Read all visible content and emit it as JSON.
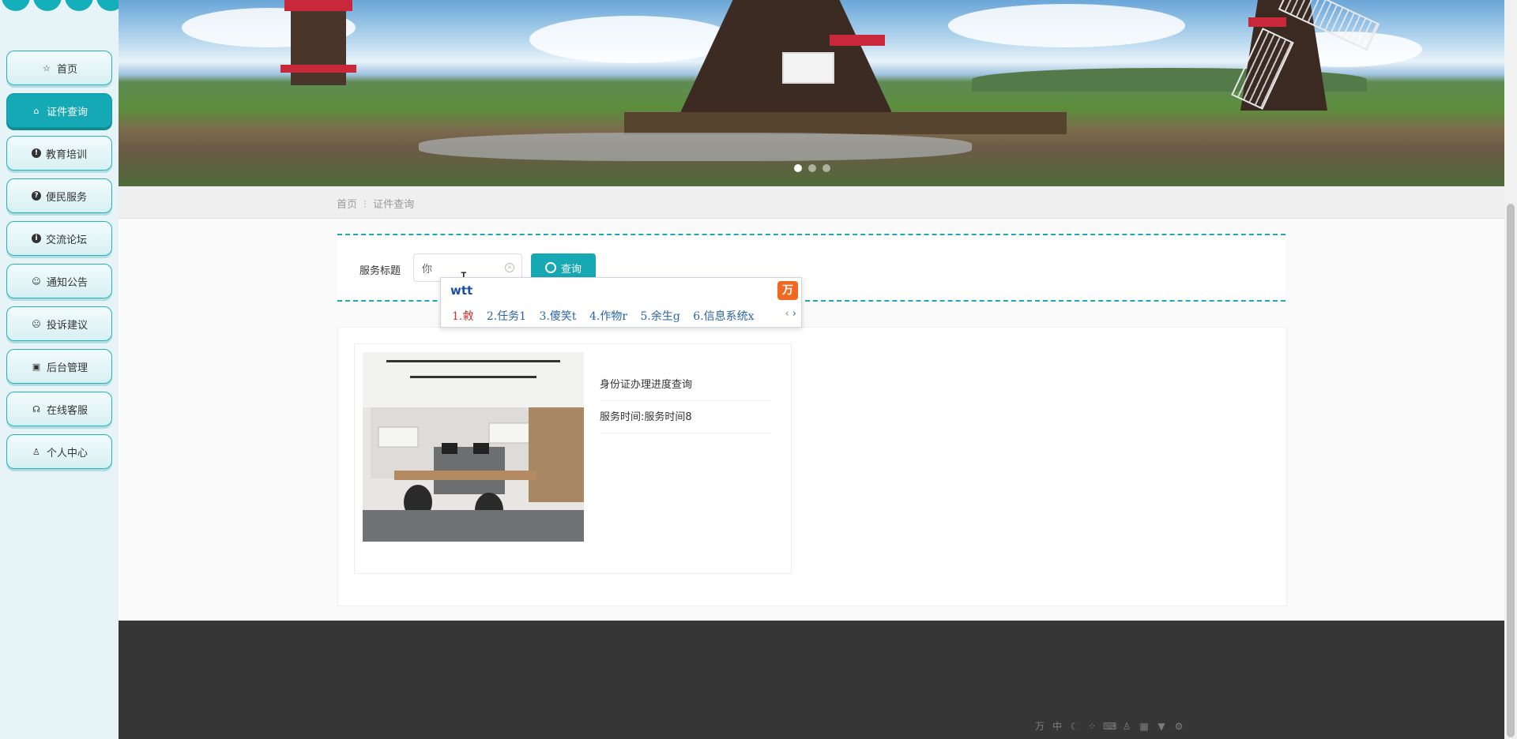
{
  "sidebar": {
    "items": [
      {
        "label": "首页",
        "icon": "star-icon"
      },
      {
        "label": "证件查询",
        "icon": "bag-icon",
        "active": true
      },
      {
        "label": "教育培训",
        "icon": "exclamation-icon"
      },
      {
        "label": "便民服务",
        "icon": "question-icon"
      },
      {
        "label": "交流论坛",
        "icon": "info-icon"
      },
      {
        "label": "通知公告",
        "icon": "smiley-icon"
      },
      {
        "label": "投诉建议",
        "icon": "face-icon"
      },
      {
        "label": "后台管理",
        "icon": "briefcase-icon"
      },
      {
        "label": "在线客服",
        "icon": "headset-icon"
      },
      {
        "label": "个人中心",
        "icon": "user-icon"
      }
    ]
  },
  "banner": {
    "slide_count": 3,
    "active_slide": 1
  },
  "breadcrumb": {
    "home": "首页",
    "separator": "⁝",
    "current": "证件查询"
  },
  "search": {
    "label": "服务标题",
    "value": "你",
    "button_label": "查询"
  },
  "ime": {
    "composition": "wtt",
    "logo": "万",
    "candidates": [
      "1.敹",
      "2.任务1",
      "3.傻笑t",
      "4.作物r",
      "5.余生g",
      "6.信息系统x"
    ],
    "prev_arrow": "‹",
    "next_arrow": "›"
  },
  "results": [
    {
      "title": "身份证办理进度查询",
      "time": "服务时间:服务时间8"
    }
  ],
  "colors": {
    "accent": "#16a8b3",
    "sidebar_bg": "#e6f4f7",
    "footer": "#363636"
  }
}
